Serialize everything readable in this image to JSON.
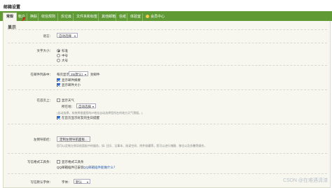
{
  "window": {
    "title": "邮箱设置"
  },
  "tabs": [
    {
      "label": "常规"
    },
    {
      "label": "帐户"
    },
    {
      "label": "换肤"
    },
    {
      "label": "收信规则"
    },
    {
      "label": "反垃圾"
    },
    {
      "label": "文件夹和标签"
    },
    {
      "label": "其他邮箱"
    },
    {
      "label": "信纸"
    },
    {
      "label": "体验室"
    },
    {
      "label": "会员中心"
    }
  ],
  "section": {
    "title": "显示"
  },
  "language": {
    "label": "语言：",
    "value": "自动选择"
  },
  "font_size": {
    "label": "文字大小：",
    "options": [
      "标准",
      "中号",
      "大号"
    ],
    "selected": "标准"
  },
  "mail_list": {
    "label": "在邮件列表中：",
    "per_page_label": "每页显示",
    "per_page_value": "25(默认)",
    "per_page_suffix": "封邮件",
    "show_summary": "显示邮件摘要",
    "show_size": "显示邮件大小",
    "show_summary_checked": true,
    "show_size_checked": true
  },
  "homepage": {
    "label": "在首页上：",
    "weather_label": "显示天气",
    "weather_checked": false,
    "location_label": "所在地：",
    "location_value": "自动选择",
    "hint": "(自动选择，系统将根据您的IP地址自动选择您所在的地方天气预报。)",
    "calendar_label": "在首页显示好友的生日提醒",
    "calendar_checked": true
  },
  "left_nav": {
    "label": "左侧导航栏：",
    "button": "定制左侧导航面板...",
    "hint": "您可以定制左侧导航面板中的服务，如: 日历、记事本、阅读空间、附件收藏等，您可以进行增删、移位以及折叠等操作。"
  },
  "format_tools": {
    "label": "写信格式工具条：",
    "option": "显示格式工具条",
    "checked": false,
    "line2": "QQ邮箱插件已安装",
    "link": "QQ邮箱插件能做什么？"
  },
  "default_font": {
    "label": "写信默认字体：",
    "font_label": "字体：",
    "font_value": "默认"
  },
  "watermark": "CSDN @在难遇清漆"
}
